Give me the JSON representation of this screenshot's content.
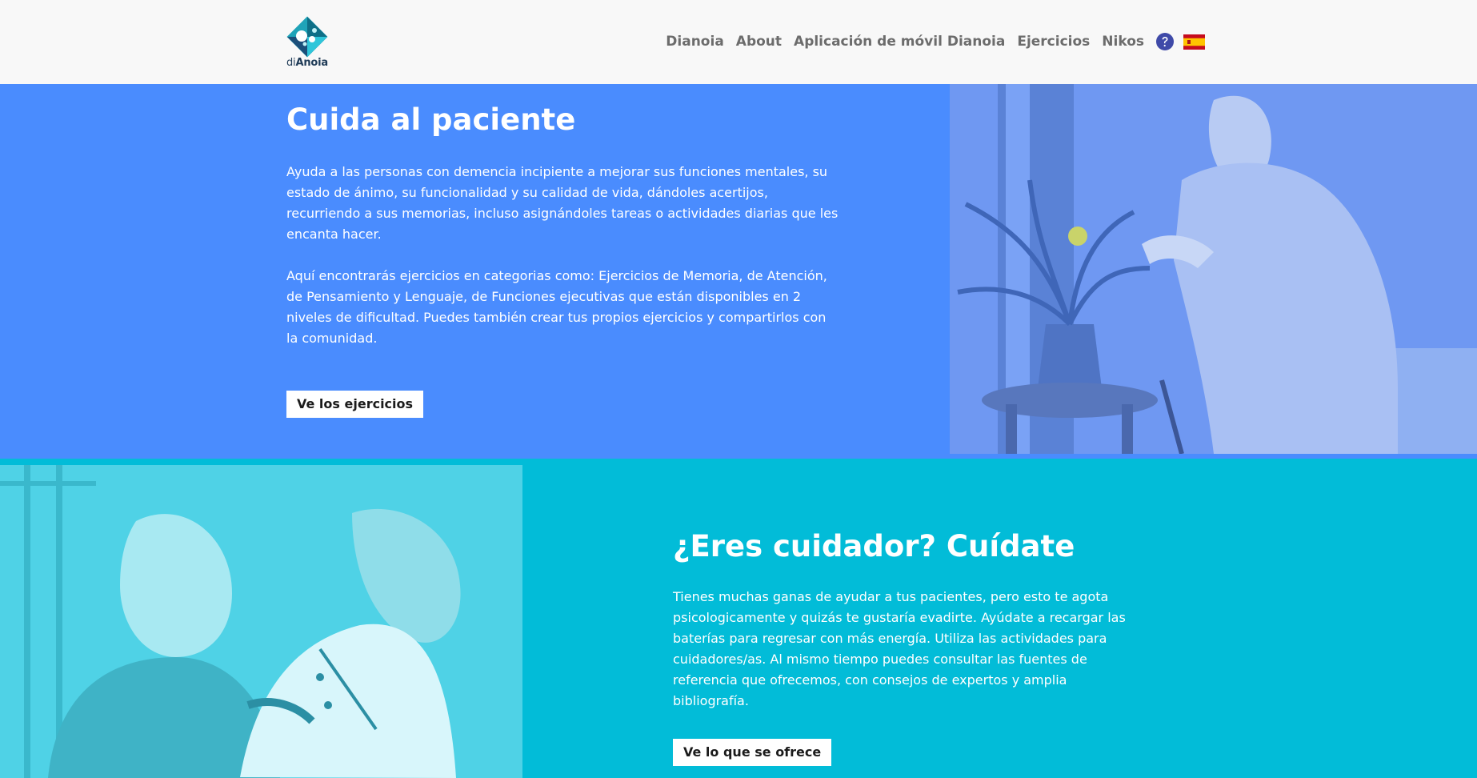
{
  "header": {
    "logo_text_light": "di",
    "logo_text_bold": "Anoia",
    "nav": [
      {
        "label": "Dianoia"
      },
      {
        "label": "About"
      },
      {
        "label": "Aplicación de móvil Dianoia"
      },
      {
        "label": "Ejercicios"
      },
      {
        "label": "Nikos"
      }
    ],
    "help_icon": "question-circle-icon",
    "language_flag": "spain-flag-icon"
  },
  "patient_section": {
    "title": "Cuida al paciente",
    "paragraph_1": "Ayuda a las personas con demencia incipiente a mejorar sus funciones mentales, su estado de ánimo, su funcionalidad y su calidad de vida, dándoles acertijos, recurriendo a sus memorias, incluso asignándoles tareas o actividades diarias que les encanta hacer.",
    "paragraph_2": "Aquí encontrarás ejercicios en categorias como: Ejercicios de Memoria, de Atención, de Pensamiento y Lenguaje, de Funciones ejecutivas que están disponibles en 2 niveles de dificultad. Puedes también crear tus propios ejercicios y compartirlos con la comunidad.",
    "button_label": "Ve los ejercicios"
  },
  "caregiver_section": {
    "title": "¿Eres cuidador? Cuídate",
    "paragraph": "Tienes muchas ganas de ayudar a tus pacientes, pero esto te agota psicologicamente y quizás te gustaría evadirte. Ayúdate a recargar las baterías para regresar con más energía. Utiliza las actividades para cuidadores/as. Al mismo tiempo puedes consultar las fuentes de referencia que ofrecemos, con consejos de expertos y amplia bibliografía.",
    "button_label": "Ve lo que se ofrece"
  },
  "colors": {
    "header_bg": "#f8f8f8",
    "nav_text": "#6c6c6c",
    "patient_bg": "#4a8cfe",
    "caregiver_bg": "#02bcd8",
    "help_icon": "#3f4aa8",
    "button_bg": "#ffffff"
  }
}
